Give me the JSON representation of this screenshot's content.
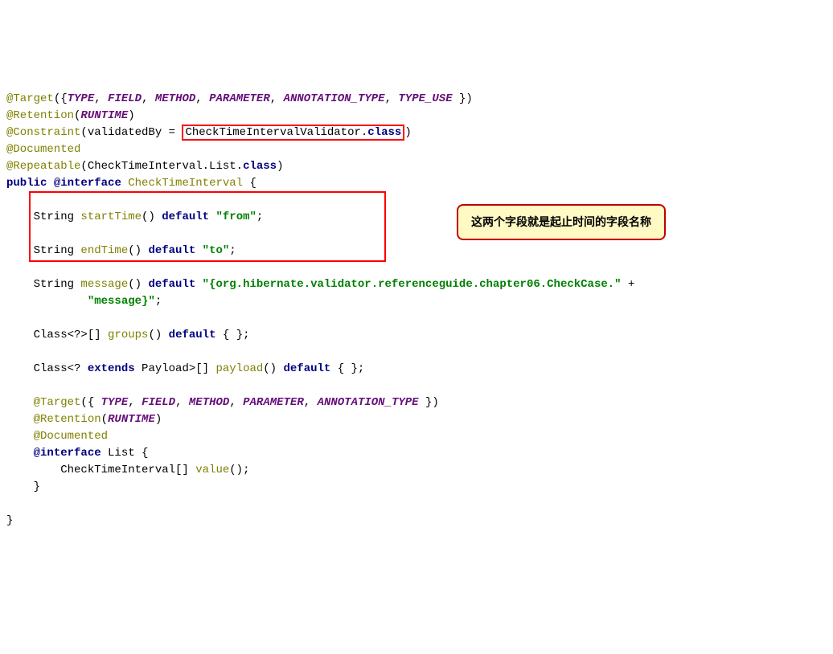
{
  "code": {
    "l1a": "@Target",
    "l1b": "({",
    "l1c": "TYPE",
    "l1d": "FIELD",
    "l1e": "METHOD",
    "l1f": "PARAMETER",
    "l1g": "ANNOTATION_TYPE",
    "l1h": "TYPE_USE",
    "l1i": " })",
    "l2a": "@Retention",
    "l2b": "(",
    "l2c": "RUNTIME",
    "l2d": ")",
    "l3a": "@Constraint",
    "l3b": "(validatedBy = ",
    "l3c": "CheckTimeIntervalValidator.",
    "l3d": "class",
    "l3e": ")",
    "l4a": "@Documented",
    "l5a": "@Repeatable",
    "l5b": "(CheckTimeInterval.List.",
    "l5c": "class",
    "l5d": ")",
    "l6a": "public",
    "l6b": "@interface",
    "l6c": "CheckTimeInterval",
    "l6d": " {",
    "l7a": "    String ",
    "l7b": "startTime",
    "l7c": "() ",
    "l7d": "default",
    "l7e": " ",
    "l7f": "\"from\"",
    "l7g": ";",
    "l8a": "    String ",
    "l8b": "endTime",
    "l8c": "() ",
    "l8d": "default",
    "l8e": " ",
    "l8f": "\"to\"",
    "l8g": ";",
    "l9a": "    String ",
    "l9b": "message",
    "l9c": "() ",
    "l9d": "default",
    "l9e": " ",
    "l9f": "\"{org.hibernate.validator.referenceguide.chapter06.CheckCase.\"",
    "l9g": " +",
    "l10a": "            ",
    "l10b": "\"message}\"",
    "l10c": ";",
    "l11a": "    Class<?>[] ",
    "l11b": "groups",
    "l11c": "() ",
    "l11d": "default",
    "l11e": " { };",
    "l12a": "    Class<? ",
    "l12b": "extends",
    "l12c": " Payload>[] ",
    "l12d": "payload",
    "l12e": "() ",
    "l12f": "default",
    "l12g": " { };",
    "l13a": "    ",
    "l13b": "@Target",
    "l13c": "({ ",
    "l13d": "TYPE",
    "l13e": "FIELD",
    "l13f": "METHOD",
    "l13g": "PARAMETER",
    "l13h": "ANNOTATION_TYPE",
    "l13i": " })",
    "l14a": "    ",
    "l14b": "@Retention",
    "l14c": "(",
    "l14d": "RUNTIME",
    "l14e": ")",
    "l15a": "    ",
    "l15b": "@Documented",
    "l16a": "    ",
    "l16b": "@interface",
    "l16c": " List {",
    "l17a": "        CheckTimeInterval[] ",
    "l17b": "value",
    "l17c": "();",
    "l18a": "    }",
    "l19a": "}",
    "comma": ", "
  },
  "callout": {
    "text": "这两个字段就是起止时间的字段名称"
  }
}
